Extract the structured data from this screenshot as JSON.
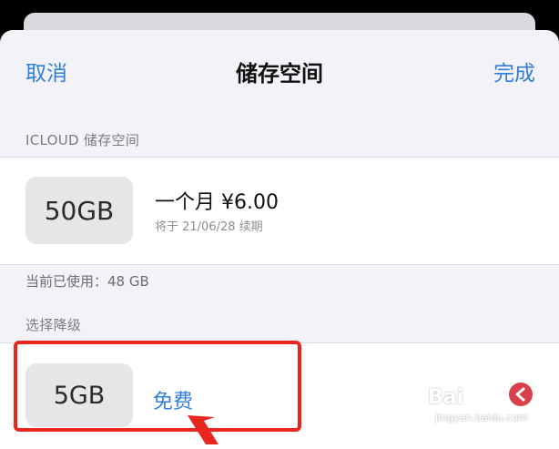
{
  "nav": {
    "cancel": "取消",
    "title": "储存空间",
    "done": "完成"
  },
  "icloud_section": {
    "header": "ICLOUD 储存空间"
  },
  "current_plan": {
    "size": "50GB",
    "price": "一个月 ¥6.00",
    "renewal": "将于 21/06/28 续期"
  },
  "usage": {
    "text": "当前已使用：48 GB"
  },
  "downgrade_section": {
    "header": "选择降级"
  },
  "downgrade_option": {
    "size": "5GB",
    "price": "免费"
  },
  "watermark": {
    "logo": "Bai",
    "site": "jingyan.baidu.com"
  },
  "colors": {
    "accent": "#2f7fd8",
    "highlight": "#e8271f",
    "destructive": "#d8414a"
  }
}
